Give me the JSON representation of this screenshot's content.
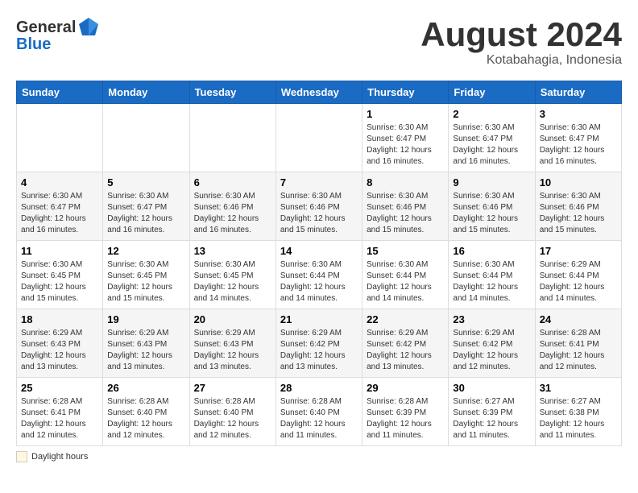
{
  "header": {
    "logo_general": "General",
    "logo_blue": "Blue",
    "month_year": "August 2024",
    "location": "Kotabahagia, Indonesia"
  },
  "days_of_week": [
    "Sunday",
    "Monday",
    "Tuesday",
    "Wednesday",
    "Thursday",
    "Friday",
    "Saturday"
  ],
  "weeks": [
    [
      {
        "day": "",
        "info": ""
      },
      {
        "day": "",
        "info": ""
      },
      {
        "day": "",
        "info": ""
      },
      {
        "day": "",
        "info": ""
      },
      {
        "day": "1",
        "info": "Sunrise: 6:30 AM\nSunset: 6:47 PM\nDaylight: 12 hours and 16 minutes."
      },
      {
        "day": "2",
        "info": "Sunrise: 6:30 AM\nSunset: 6:47 PM\nDaylight: 12 hours and 16 minutes."
      },
      {
        "day": "3",
        "info": "Sunrise: 6:30 AM\nSunset: 6:47 PM\nDaylight: 12 hours and 16 minutes."
      }
    ],
    [
      {
        "day": "4",
        "info": "Sunrise: 6:30 AM\nSunset: 6:47 PM\nDaylight: 12 hours and 16 minutes."
      },
      {
        "day": "5",
        "info": "Sunrise: 6:30 AM\nSunset: 6:47 PM\nDaylight: 12 hours and 16 minutes."
      },
      {
        "day": "6",
        "info": "Sunrise: 6:30 AM\nSunset: 6:46 PM\nDaylight: 12 hours and 16 minutes."
      },
      {
        "day": "7",
        "info": "Sunrise: 6:30 AM\nSunset: 6:46 PM\nDaylight: 12 hours and 15 minutes."
      },
      {
        "day": "8",
        "info": "Sunrise: 6:30 AM\nSunset: 6:46 PM\nDaylight: 12 hours and 15 minutes."
      },
      {
        "day": "9",
        "info": "Sunrise: 6:30 AM\nSunset: 6:46 PM\nDaylight: 12 hours and 15 minutes."
      },
      {
        "day": "10",
        "info": "Sunrise: 6:30 AM\nSunset: 6:46 PM\nDaylight: 12 hours and 15 minutes."
      }
    ],
    [
      {
        "day": "11",
        "info": "Sunrise: 6:30 AM\nSunset: 6:45 PM\nDaylight: 12 hours and 15 minutes."
      },
      {
        "day": "12",
        "info": "Sunrise: 6:30 AM\nSunset: 6:45 PM\nDaylight: 12 hours and 15 minutes."
      },
      {
        "day": "13",
        "info": "Sunrise: 6:30 AM\nSunset: 6:45 PM\nDaylight: 12 hours and 14 minutes."
      },
      {
        "day": "14",
        "info": "Sunrise: 6:30 AM\nSunset: 6:44 PM\nDaylight: 12 hours and 14 minutes."
      },
      {
        "day": "15",
        "info": "Sunrise: 6:30 AM\nSunset: 6:44 PM\nDaylight: 12 hours and 14 minutes."
      },
      {
        "day": "16",
        "info": "Sunrise: 6:30 AM\nSunset: 6:44 PM\nDaylight: 12 hours and 14 minutes."
      },
      {
        "day": "17",
        "info": "Sunrise: 6:29 AM\nSunset: 6:44 PM\nDaylight: 12 hours and 14 minutes."
      }
    ],
    [
      {
        "day": "18",
        "info": "Sunrise: 6:29 AM\nSunset: 6:43 PM\nDaylight: 12 hours and 13 minutes."
      },
      {
        "day": "19",
        "info": "Sunrise: 6:29 AM\nSunset: 6:43 PM\nDaylight: 12 hours and 13 minutes."
      },
      {
        "day": "20",
        "info": "Sunrise: 6:29 AM\nSunset: 6:43 PM\nDaylight: 12 hours and 13 minutes."
      },
      {
        "day": "21",
        "info": "Sunrise: 6:29 AM\nSunset: 6:42 PM\nDaylight: 12 hours and 13 minutes."
      },
      {
        "day": "22",
        "info": "Sunrise: 6:29 AM\nSunset: 6:42 PM\nDaylight: 12 hours and 13 minutes."
      },
      {
        "day": "23",
        "info": "Sunrise: 6:29 AM\nSunset: 6:42 PM\nDaylight: 12 hours and 12 minutes."
      },
      {
        "day": "24",
        "info": "Sunrise: 6:28 AM\nSunset: 6:41 PM\nDaylight: 12 hours and 12 minutes."
      }
    ],
    [
      {
        "day": "25",
        "info": "Sunrise: 6:28 AM\nSunset: 6:41 PM\nDaylight: 12 hours and 12 minutes."
      },
      {
        "day": "26",
        "info": "Sunrise: 6:28 AM\nSunset: 6:40 PM\nDaylight: 12 hours and 12 minutes."
      },
      {
        "day": "27",
        "info": "Sunrise: 6:28 AM\nSunset: 6:40 PM\nDaylight: 12 hours and 12 minutes."
      },
      {
        "day": "28",
        "info": "Sunrise: 6:28 AM\nSunset: 6:40 PM\nDaylight: 12 hours and 11 minutes."
      },
      {
        "day": "29",
        "info": "Sunrise: 6:28 AM\nSunset: 6:39 PM\nDaylight: 12 hours and 11 minutes."
      },
      {
        "day": "30",
        "info": "Sunrise: 6:27 AM\nSunset: 6:39 PM\nDaylight: 12 hours and 11 minutes."
      },
      {
        "day": "31",
        "info": "Sunrise: 6:27 AM\nSunset: 6:38 PM\nDaylight: 12 hours and 11 minutes."
      }
    ]
  ],
  "footer": {
    "daylight_label": "Daylight hours"
  }
}
